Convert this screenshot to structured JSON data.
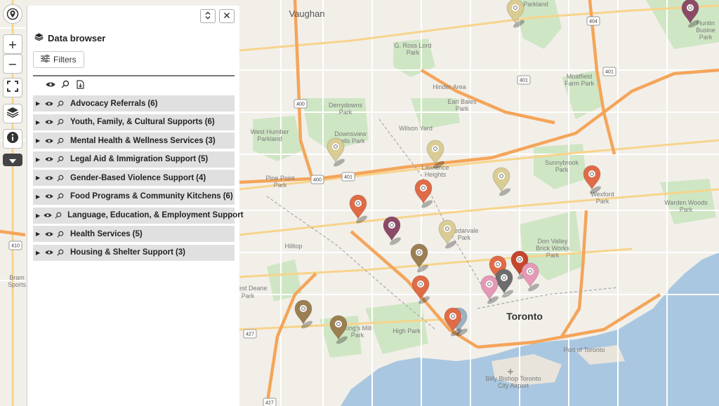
{
  "map": {
    "labels": [
      {
        "text": "Vaughan",
        "cls": "map-label-big"
      },
      {
        "text": "Parkland",
        "cls": "map-label"
      },
      {
        "text": "G. Ross Lord",
        "cls": "map-label"
      },
      {
        "text": "Park",
        "cls": "map-label"
      },
      {
        "text": "Hinder Area",
        "cls": "map-label"
      },
      {
        "text": "Moatfield",
        "cls": "map-label"
      },
      {
        "text": "Farm Park",
        "cls": "map-label"
      },
      {
        "text": "Derrydowns",
        "cls": "map-label"
      },
      {
        "text": "Park",
        "cls": "map-label"
      },
      {
        "text": "Earl Bales",
        "cls": "map-label"
      },
      {
        "text": "Park",
        "cls": "map-label"
      },
      {
        "text": "Downsview",
        "cls": "map-label"
      },
      {
        "text": "Dells Park",
        "cls": "map-label"
      },
      {
        "text": "Wilson Yard",
        "cls": "map-label"
      },
      {
        "text": "West Humber",
        "cls": "map-label"
      },
      {
        "text": "Parkland",
        "cls": "map-label"
      },
      {
        "text": "Sunnybrook",
        "cls": "map-label"
      },
      {
        "text": "Park",
        "cls": "map-label"
      },
      {
        "text": "Pine Point",
        "cls": "map-label"
      },
      {
        "text": "Park",
        "cls": "map-label"
      },
      {
        "text": "Lawrence",
        "cls": "map-label"
      },
      {
        "text": "Heights",
        "cls": "map-label"
      },
      {
        "text": "Wexford",
        "cls": "map-label"
      },
      {
        "text": "Park",
        "cls": "map-label"
      },
      {
        "text": "Warden Woods",
        "cls": "map-label"
      },
      {
        "text": "Park",
        "cls": "map-label"
      },
      {
        "text": "Cedarvale",
        "cls": "map-label"
      },
      {
        "text": "Park",
        "cls": "map-label"
      },
      {
        "text": "Hilltop",
        "cls": "map-label"
      },
      {
        "text": "Don Valley",
        "cls": "map-label"
      },
      {
        "text": "Brick Works",
        "cls": "map-label"
      },
      {
        "text": "Park",
        "cls": "map-label"
      },
      {
        "text": "Bram",
        "cls": "map-label"
      },
      {
        "text": "Sports",
        "cls": "map-label"
      },
      {
        "text": "est Deane",
        "cls": "map-label"
      },
      {
        "text": "Park",
        "cls": "map-label"
      },
      {
        "text": "King's Mill",
        "cls": "map-label"
      },
      {
        "text": "Park",
        "cls": "map-label"
      },
      {
        "text": "High Park",
        "cls": "map-label"
      },
      {
        "text": "Port of Toronto",
        "cls": "map-label"
      },
      {
        "text": "Billy Bishop Toronto",
        "cls": "map-label"
      },
      {
        "text": "City Airport",
        "cls": "map-label"
      },
      {
        "text": "Huntin",
        "cls": "map-label"
      },
      {
        "text": "Busine",
        "cls": "map-label"
      },
      {
        "text": "Park",
        "cls": "map-label"
      }
    ],
    "city": "Toronto",
    "shields": [
      "404",
      "401",
      "401",
      "400",
      "400",
      "401",
      "410",
      "427",
      "427"
    ],
    "markers": [
      {
        "color": "#d9cc94"
      },
      {
        "color": "#8c4a67"
      },
      {
        "color": "#d9cc94"
      },
      {
        "color": "#d9cc94"
      },
      {
        "color": "#d9cc94"
      },
      {
        "color": "#e06b47"
      },
      {
        "color": "#e06b47"
      },
      {
        "color": "#e06b47"
      },
      {
        "color": "#8c4a67"
      },
      {
        "color": "#d9cc94"
      },
      {
        "color": "#9b7f52"
      },
      {
        "color": "#e06b47"
      },
      {
        "color": "#c6462d"
      },
      {
        "color": "#6d6d6d"
      },
      {
        "color": "#e599b6"
      },
      {
        "color": "#e599b6"
      },
      {
        "color": "#e06b47"
      },
      {
        "color": "#9bb2c2"
      },
      {
        "color": "#e06b47"
      },
      {
        "color": "#9b7f52"
      },
      {
        "color": "#9b7f52"
      }
    ]
  },
  "toolbar": {
    "zoom_in": "+",
    "zoom_out": "−"
  },
  "panel": {
    "title": "Data browser",
    "filters_label": "Filters",
    "layers": [
      {
        "name": "Advocacy Referrals",
        "count": "(6)"
      },
      {
        "name": "Youth, Family, & Cultural Supports",
        "count": "(6)"
      },
      {
        "name": "Mental Health & Wellness Services",
        "count": "(3)"
      },
      {
        "name": "Legal Aid & Immigration Support",
        "count": "(5)"
      },
      {
        "name": "Gender-Based Violence Support",
        "count": "(4)"
      },
      {
        "name": "Food Programs & Community Kitchens",
        "count": "(6)"
      },
      {
        "name": "Language, Education, & Employment Support",
        "count": ""
      },
      {
        "name": "Health Services",
        "count": "(5)"
      },
      {
        "name": "Housing & Shelter Support",
        "count": "(3)"
      }
    ]
  }
}
